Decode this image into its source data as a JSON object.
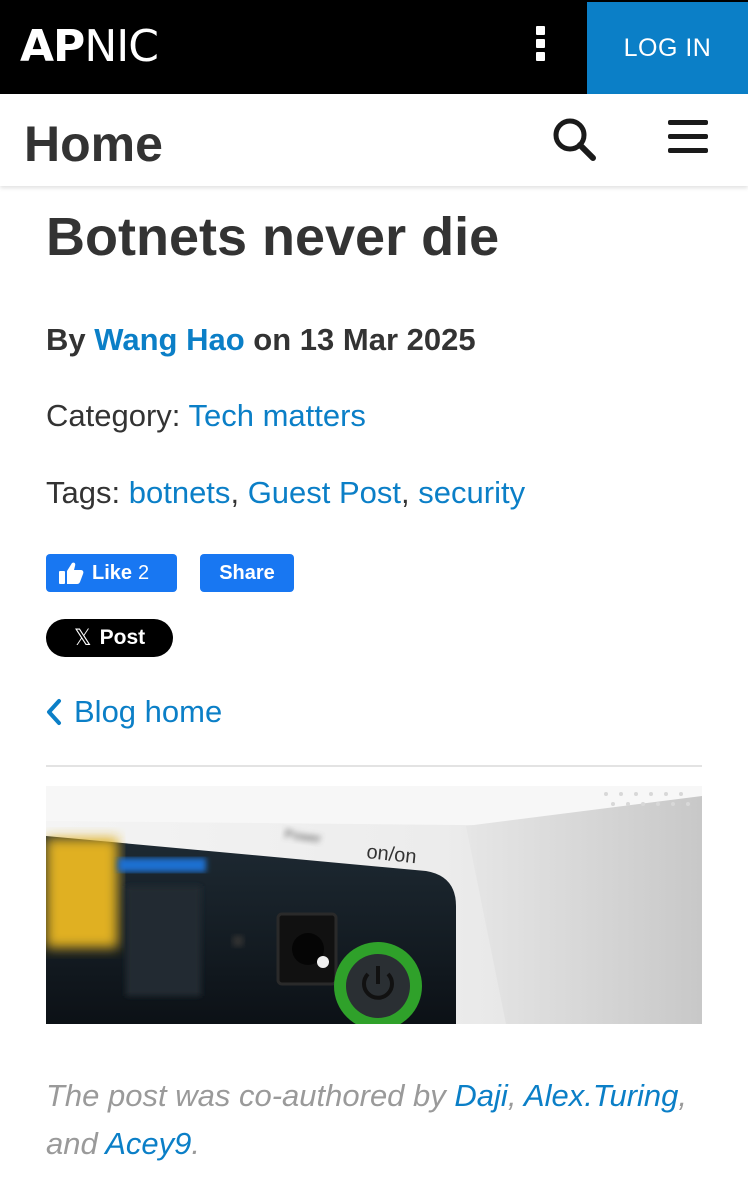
{
  "topbar": {
    "logo_ap": "AP",
    "logo_nic": "NIC",
    "login_label": "LOG IN",
    "bg_color": "#000000",
    "login_color": "#0b7fc7"
  },
  "subheader": {
    "title": "Home",
    "search_icon": "search-icon",
    "menu_icon": "hamburger-menu-icon"
  },
  "article": {
    "title": "Botnets never die",
    "byline_prefix": "By",
    "author": "Wang Hao",
    "byline_mid": "on 13 Mar 2025",
    "category_label": "Category:",
    "category": "Tech matters",
    "tags_label": "Tags:",
    "tags": [
      "botnets",
      "Guest Post",
      "security"
    ],
    "tag_separator": ","
  },
  "social": {
    "fb_like_label": "Like",
    "fb_like_count": "2",
    "fb_share_label": "Share",
    "x_glyph": "𝕏",
    "x_post_label": "Post"
  },
  "nav": {
    "blog_home_label": "Blog home"
  },
  "hero_image": {
    "labels": [
      "on/on",
      "Power"
    ]
  },
  "caption": {
    "prefix": "The post was co-authored by",
    "author1": "Daji",
    "sep1": ",",
    "author2": "Alex.Turing",
    "sep2": ", and",
    "author3": "Acey9",
    "end": "."
  },
  "colors": {
    "accent": "#0b7fc7",
    "facebook": "#1877f2",
    "text": "#333333",
    "caption": "#9a9a9a"
  }
}
